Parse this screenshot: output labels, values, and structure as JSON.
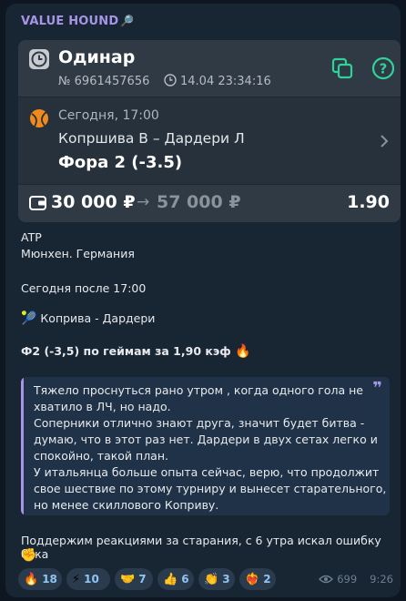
{
  "sender": {
    "name": "VALUE HOUND",
    "emoji": "🔎"
  },
  "bet_card": {
    "title": "Одинар",
    "id_text": "№ 6961457656",
    "datetime": "14.04 23:34:16",
    "event_time": "Сегодня, 17:00",
    "teams": "Копршива В – Дардери Л",
    "bet": "Фора 2 (-3.5)",
    "stake": "30 000 ₽",
    "arrow": "→",
    "payout": "57 000 ₽",
    "odds": "1.90"
  },
  "message": {
    "line1": "ATP",
    "line2": "Мюнхен. Германия",
    "line3": "Сегодня после 17:00",
    "match_emoji": "🎾",
    "match": "Коприва - Дардери",
    "bet_line": "Ф2 (-3,5) по геймам за 1,90 кэф",
    "bet_emoji": "🔥",
    "quote_lines": [
      "Тяжело проснуться рано утром , когда одного гола не",
      "хватило в ЛЧ, но надо.",
      "Соперники отлично знают друга, значит будет битва -",
      "думаю, что в этот раз нет. Дардери в двух сетах легко и",
      "спокойно, такой план.",
      "У итальянца больше опыта сейчас, верю, что продолжит",
      "свое шествие по этому турниру и вынесет старательного,",
      "но менее скиллового Коприву."
    ],
    "footer": "Поддержим реакциями за старания, с 6 утра искал ошибку бука",
    "footer_emoji": "✊"
  },
  "reactions": [
    {
      "icon": "🔥",
      "count": "18"
    },
    {
      "icon": "⚡",
      "count": "10"
    },
    {
      "icon": "🤝",
      "count": "7"
    },
    {
      "icon": "👍",
      "count": "6"
    },
    {
      "icon": "👏",
      "count": "3"
    },
    {
      "icon": "❤️‍🔥",
      "count": "2"
    }
  ],
  "meta": {
    "views": "699",
    "time": "9:26"
  }
}
